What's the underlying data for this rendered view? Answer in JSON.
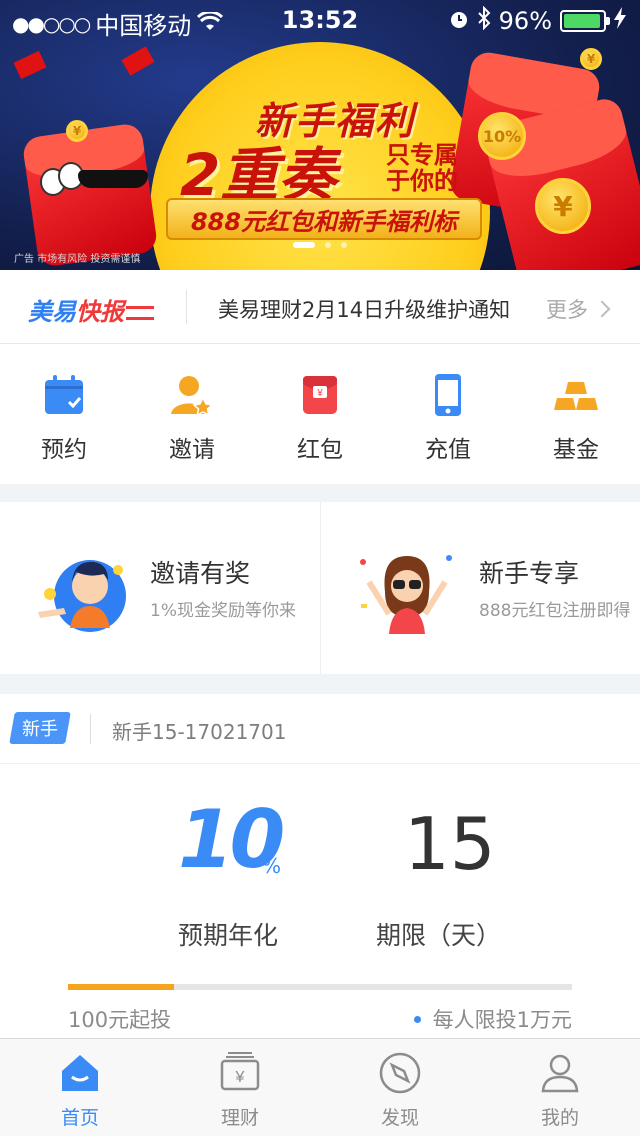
{
  "status_bar": {
    "carrier": "中国移动",
    "time": "13:52",
    "battery_percent": "96%",
    "battery_level": 0.96,
    "signal_dots_filled": 2,
    "signal_dots_total": 5
  },
  "banner": {
    "headline": "新手福利",
    "big_text": "2重奏",
    "side_text_line1": "只专属",
    "side_text_line2": "于你的",
    "ribbon_text": "888元红包和新手福利标",
    "ad_notice": "广告 市场有风险 投资需谨慎",
    "coin_badge": "10%",
    "coin_symbol": "¥",
    "slide_count": 3,
    "active_slide": 1
  },
  "news": {
    "brand_prefix": "美易",
    "brand_suffix": "快报",
    "headline": "美易理财2月14日升级维护通知",
    "more_label": "更多"
  },
  "quick_menu": [
    {
      "label": "预约",
      "icon": "calendar-icon",
      "color": "#3a8bf5"
    },
    {
      "label": "邀请",
      "icon": "invite-user-star-icon",
      "color": "#f5a623"
    },
    {
      "label": "红包",
      "icon": "red-packet-icon",
      "color": "#f2464b"
    },
    {
      "label": "充值",
      "icon": "phone-recharge-icon",
      "color": "#3a8bf5"
    },
    {
      "label": "基金",
      "icon": "gold-bars-icon",
      "color": "#f5a623"
    }
  ],
  "promos": [
    {
      "title": "邀请有奖",
      "subtitle": "1%现金奖励等你来",
      "icon": "invite-boy-avatar"
    },
    {
      "title": "新手专享",
      "subtitle": "888元红包注册即得",
      "icon": "newbie-girl-avatar"
    }
  ],
  "product": {
    "tag": "新手",
    "name": "新手15-17021701",
    "rate_value": "10",
    "rate_unit": "%",
    "rate_label": "预期年化",
    "term_value": "15",
    "term_label": "期限（天）",
    "progress": 0.21,
    "min_investment": "100元起投",
    "limit_text": "每人限投1万元"
  },
  "tabbar": [
    {
      "label": "首页",
      "icon": "home-icon",
      "active": true
    },
    {
      "label": "理财",
      "icon": "finance-yen-icon",
      "active": false
    },
    {
      "label": "发现",
      "icon": "compass-icon",
      "active": false
    },
    {
      "label": "我的",
      "icon": "user-profile-icon",
      "active": false
    }
  ],
  "colors": {
    "primary": "#3a8bf5",
    "accent_orange": "#f4a51c",
    "red": "#ee3a3a"
  }
}
